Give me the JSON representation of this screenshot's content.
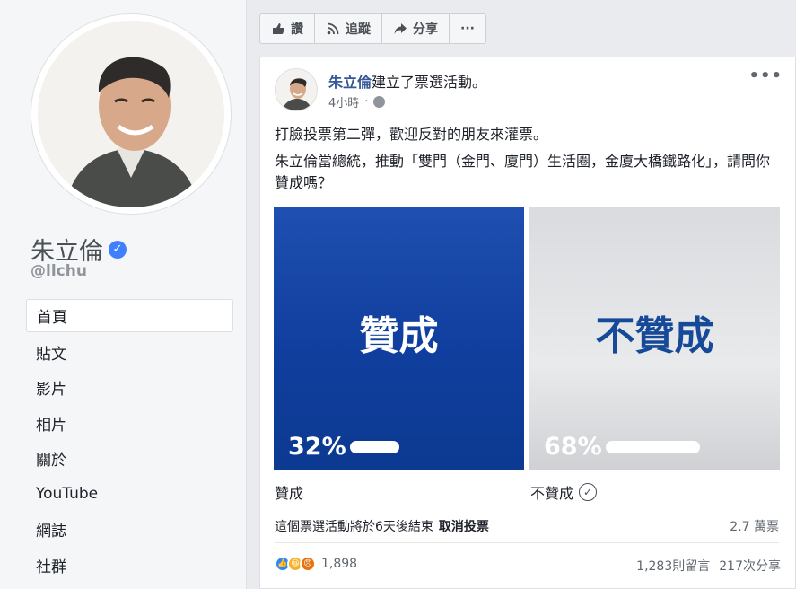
{
  "profile": {
    "name": "朱立倫",
    "handle": "@llchu",
    "verified_icon": "verified-badge-icon",
    "accent_color": "#4080ff"
  },
  "nav": {
    "items": [
      {
        "label": "首頁",
        "active": true
      },
      {
        "label": "貼文"
      },
      {
        "label": "影片"
      },
      {
        "label": "相片"
      },
      {
        "label": "關於"
      },
      {
        "label": "YouTube"
      },
      {
        "label": "網誌"
      },
      {
        "label": "社群"
      }
    ]
  },
  "actionbar": {
    "like": "讚",
    "follow": "追蹤",
    "share": "分享",
    "more": "···"
  },
  "post": {
    "author": "朱立倫",
    "action": "建立了票選活動。",
    "time": "4小時",
    "more": "•••",
    "text1": "打臉投票第二彈，歡迎反對的朋友來灌票。",
    "text2": "朱立倫當總統，推動「雙門（金門、廈門）生活圈，金廈大橋鐵路化」，請問你贊成嗎？",
    "poll": {
      "options": [
        {
          "title": "贊成",
          "percent_label": "32%",
          "percent": 32,
          "label": "贊成",
          "color": "#1f4fb0"
        },
        {
          "title": "不贊成",
          "percent_label": "68%",
          "percent": 68,
          "label": "不贊成",
          "selected": true,
          "color": "#164a98"
        }
      ],
      "ends_text": "這個票選活動將於6天後結束",
      "cancel_label": "取消投票",
      "votes": "2.7 萬票"
    },
    "reactions": {
      "count": "1,898",
      "icons": [
        "like-icon",
        "haha-icon",
        "angry-icon"
      ]
    },
    "comments": "1,283則留言",
    "shares": "217次分享"
  }
}
